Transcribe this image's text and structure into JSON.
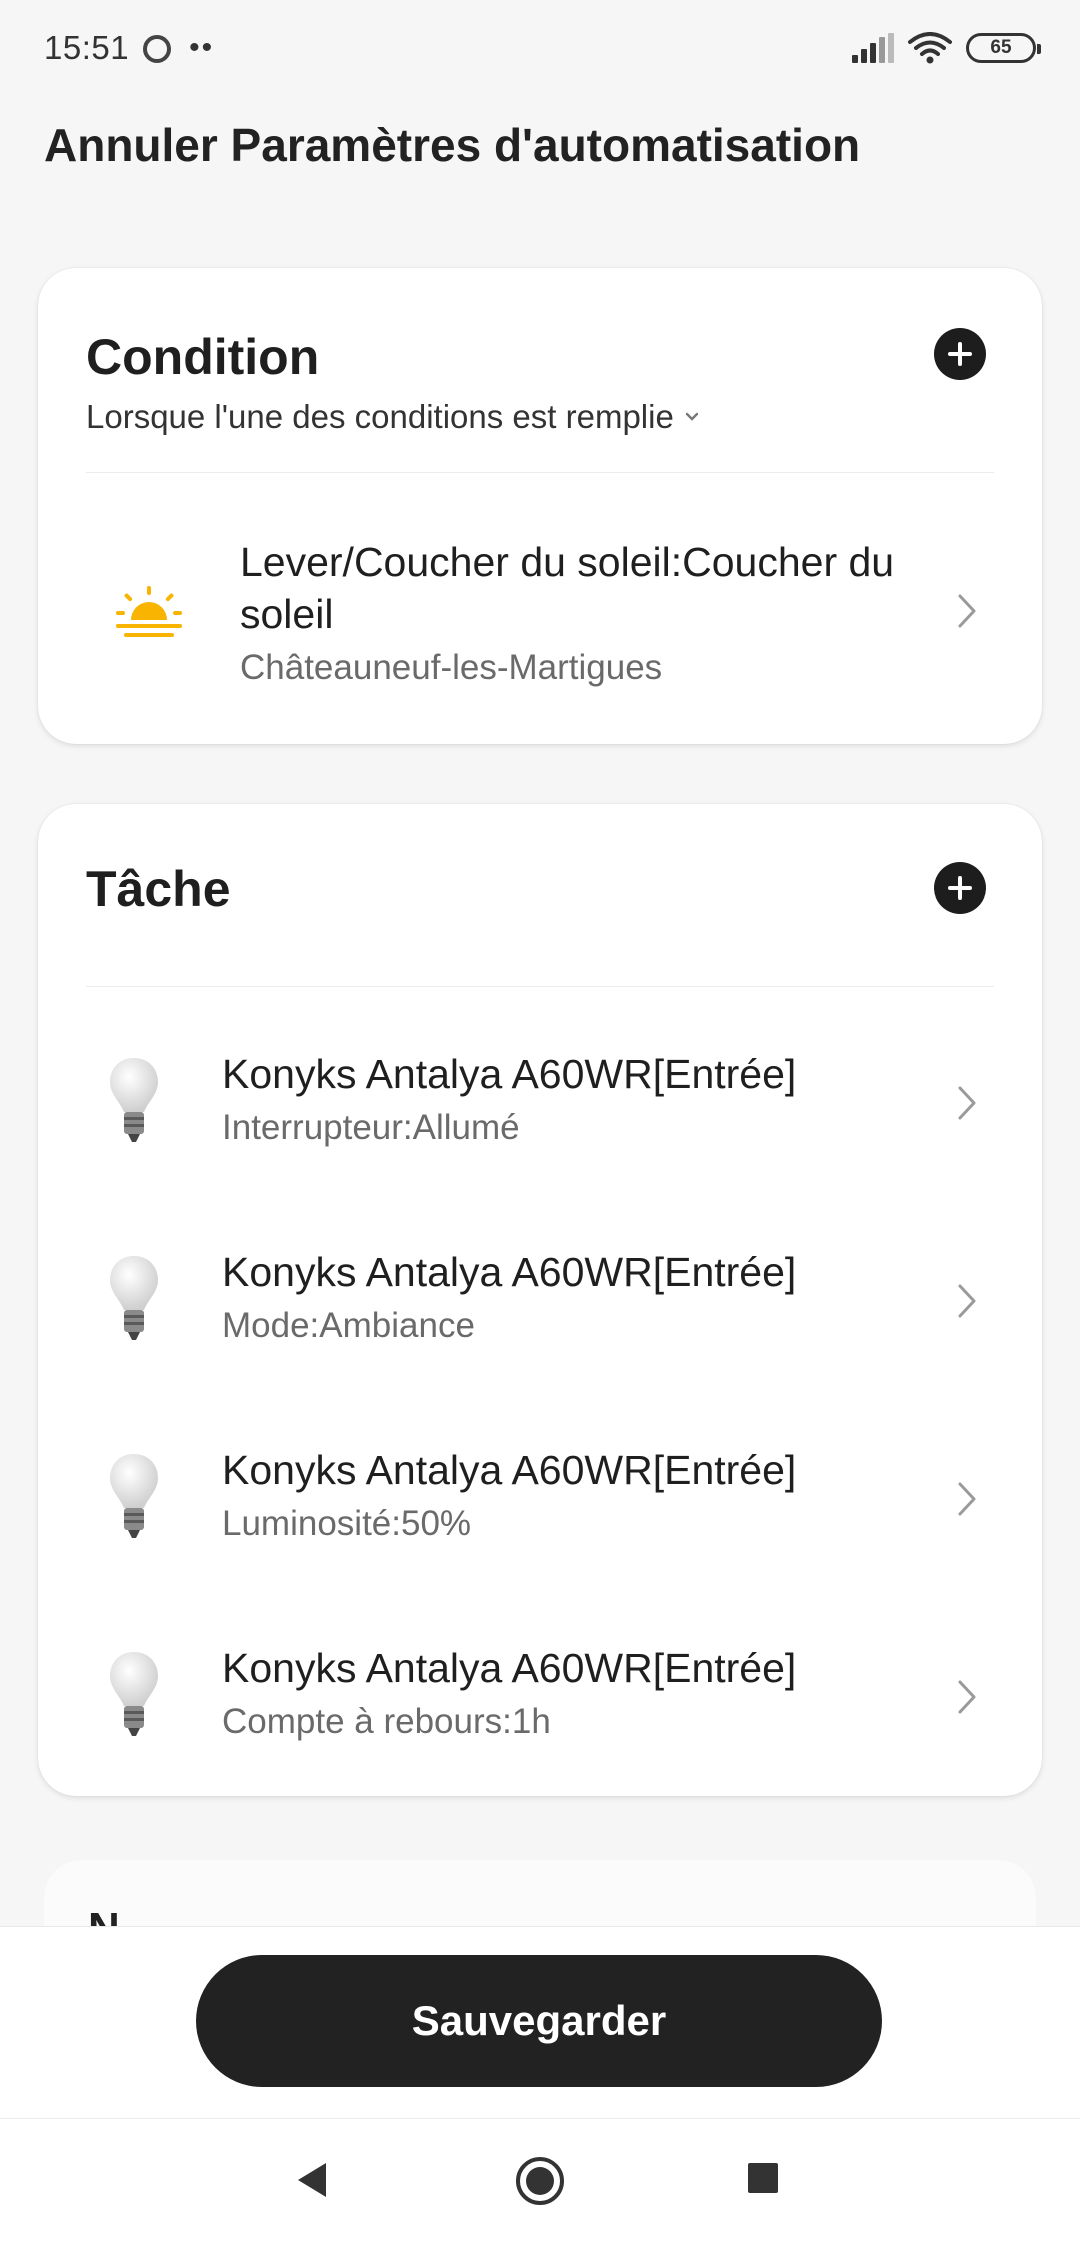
{
  "status_bar": {
    "time": "15:51",
    "dots": "••",
    "battery": "65"
  },
  "header": {
    "title": "Annuler Paramètres d'automatisation"
  },
  "condition": {
    "title": "Condition",
    "subtitle": "Lorsque l'une des conditions est remplie",
    "item": {
      "icon": "sunset-icon",
      "label": "Lever/Coucher du soleil:Coucher du soleil",
      "detail": "Châteauneuf-les-Martigues"
    }
  },
  "task": {
    "title": "Tâche",
    "items": [
      {
        "icon": "bulb-icon",
        "label": "Konyks Antalya A60WR[Entrée]",
        "detail": "Interrupteur:Allumé"
      },
      {
        "icon": "bulb-icon",
        "label": "Konyks Antalya A60WR[Entrée]",
        "detail": "Mode:Ambiance"
      },
      {
        "icon": "bulb-icon",
        "label": "Konyks Antalya A60WR[Entrée]",
        "detail": "Luminosité:50%"
      },
      {
        "icon": "bulb-icon",
        "label": "Konyks Antalya A60WR[Entrée]",
        "detail": "Compte à rebours:1h"
      }
    ]
  },
  "partial_section": {
    "title": "N"
  },
  "footer": {
    "save_label": "Sauvegarder"
  },
  "colors": {
    "accent_dark": "#222222",
    "sun": "#f8b400"
  }
}
